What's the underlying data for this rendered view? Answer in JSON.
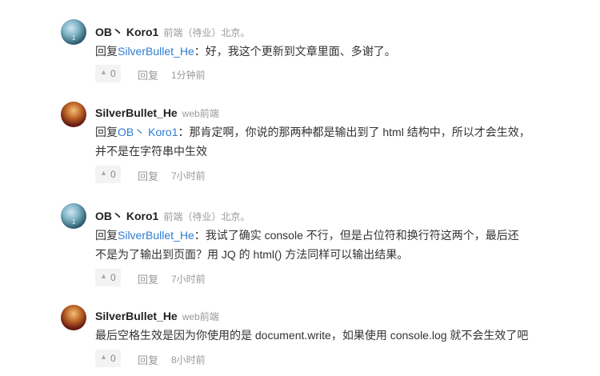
{
  "comments": [
    {
      "name": "OB丶 Koro1",
      "tag": "前端（待业）北京。",
      "prefix": "回复",
      "mention": "SilverBullet_He",
      "lines": [
        "：好，我这个更新到文章里面、多谢了。"
      ],
      "votes": "0",
      "reply": "回复",
      "time": "1分钟前"
    },
    {
      "name": "SilverBullet_He",
      "tag": "web前端",
      "prefix": "回复",
      "mention": "OB丶 Koro1",
      "lines": [
        "：那肯定啊，你说的那两种都是输出到了 html 结构中，所以才会生效，",
        "并不是在字符串中生效"
      ],
      "votes": "0",
      "reply": "回复",
      "time": "7小时前"
    },
    {
      "name": "OB丶 Koro1",
      "tag": "前端（待业）北京。",
      "prefix": "回复",
      "mention": "SilverBullet_He",
      "lines": [
        "：我试了确实 console 不行，但是占位符和换行符这两个，最后还",
        "不是为了输出到页面？用 JQ 的 html() 方法同样可以输出结果。"
      ],
      "votes": "0",
      "reply": "回复",
      "time": "7小时前"
    },
    {
      "name": "SilverBullet_He",
      "tag": "web前端",
      "lines": [
        "最后空格生效是因为你使用的是 document.write，如果使用 console.log 就不会生效了吧"
      ],
      "votes": "0",
      "reply": "回复",
      "time": "8小时前"
    }
  ]
}
